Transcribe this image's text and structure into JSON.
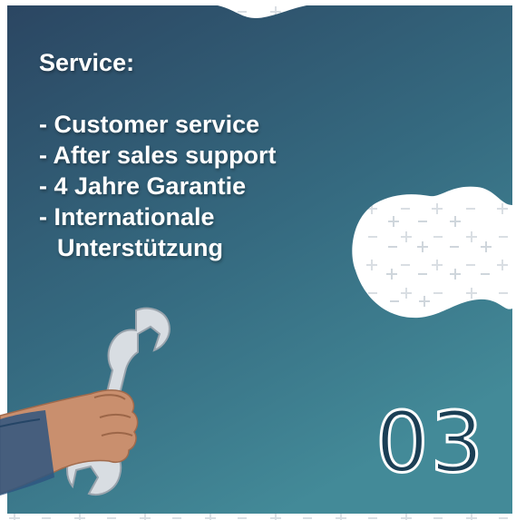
{
  "panel": {
    "heading": "Service:",
    "items": [
      "- Customer service",
      "- After sales support",
      "- 4 Jahre Garantie",
      "- Internationale",
      "Unterstützung"
    ]
  },
  "badge": {
    "number": "03"
  },
  "colors": {
    "panel_gradient_top": "#2c4863",
    "panel_gradient_bottom": "#3f8393",
    "number_fill": "#1b3f55",
    "text": "#ffffff",
    "pattern": "#dde2e6"
  },
  "icons": [
    "plus-minus-pattern",
    "wrench-in-hand-illustration"
  ]
}
